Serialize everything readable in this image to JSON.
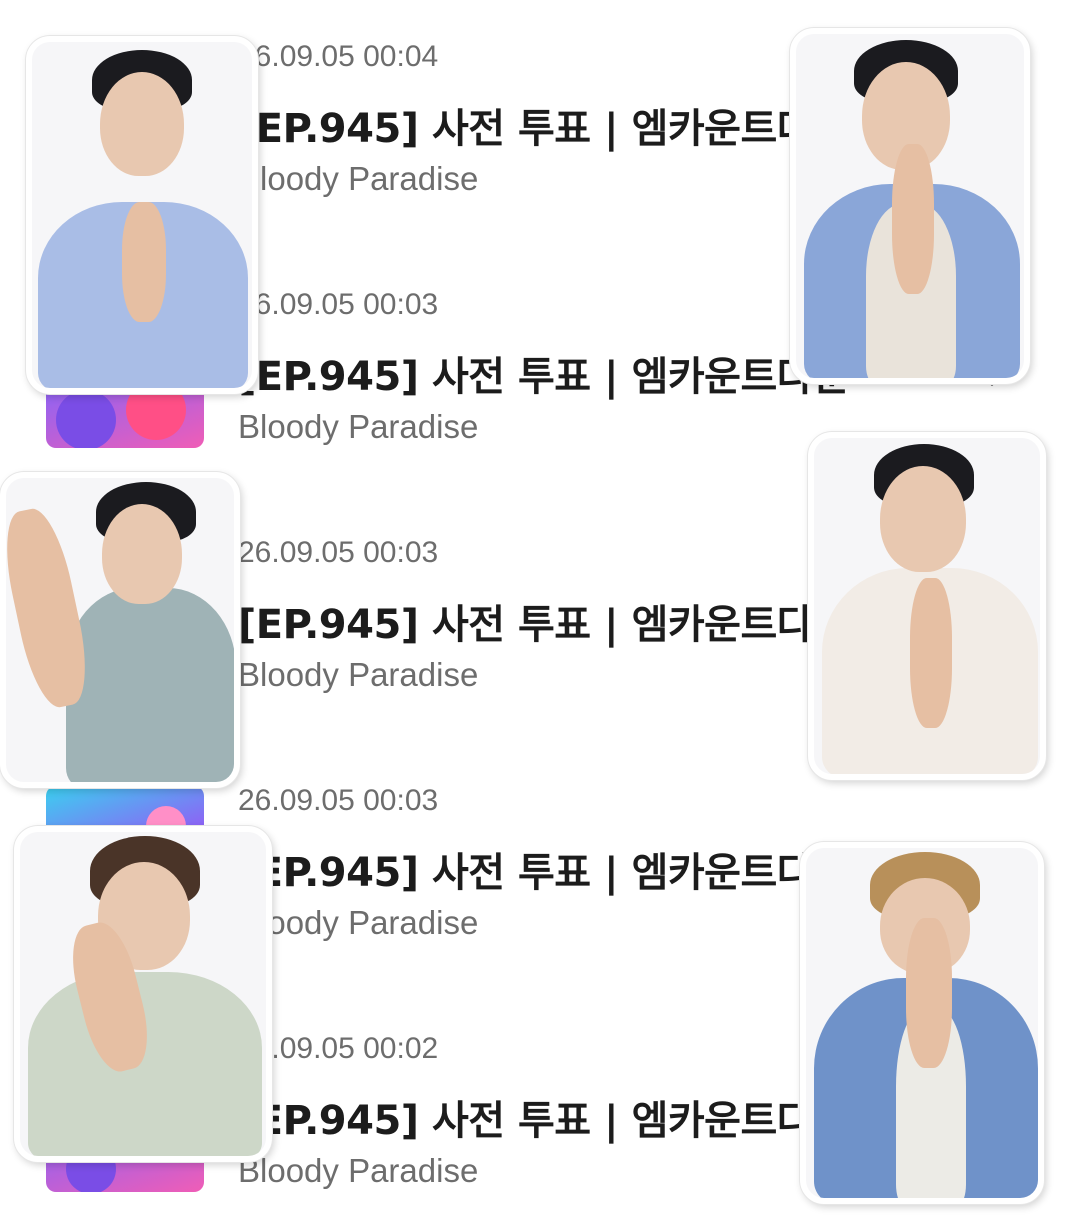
{
  "rows": [
    {
      "date": "26.09.05 00:04",
      "title": "[EP.945] 사전 투표 | 엠카운트다운",
      "artist": "Bloody Paradise"
    },
    {
      "date": "26.09.05 00:03",
      "title": "[EP.945] 사전 투표 | 엠카운트다운",
      "artist": "Bloody Paradise"
    },
    {
      "date": "26.09.05 00:03",
      "title": "[EP.945] 사전 투표 | 엠카운트다운",
      "artist": "Bloody Paradise"
    },
    {
      "date": "26.09.05 00:03",
      "title": "[EP.945] 사전 투표 | 엠카운트다운",
      "artist": "Bloody Paradise"
    },
    {
      "date": "26.09.05 00:02",
      "title": "[EP.945] 사전 투표 | 엠카운트다운",
      "artist": "Bloody Paradise"
    }
  ],
  "icons": {
    "chevron": "chevron-right-icon",
    "thumbnail": "mcountdown-thumbnail"
  },
  "colors": {
    "text_primary": "#1c1c1c",
    "text_secondary": "#6d6d6d",
    "background": "#ffffff"
  }
}
